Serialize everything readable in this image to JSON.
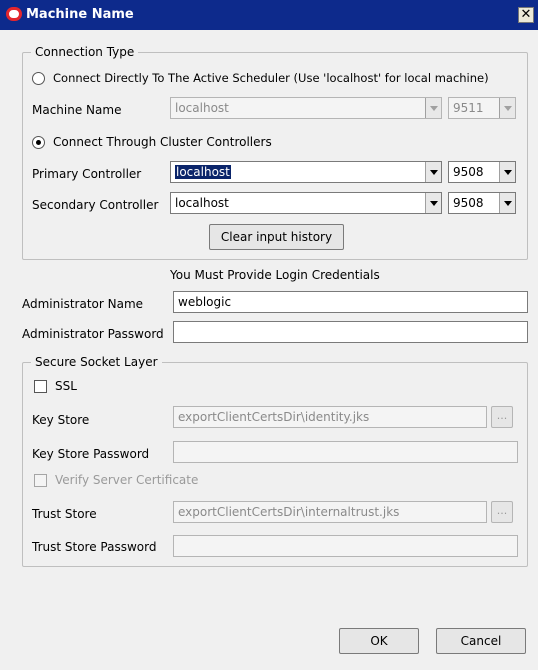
{
  "window": {
    "title": "Machine Name",
    "close_glyph": "✕"
  },
  "connection": {
    "legend": "Connection Type",
    "direct_option": "Connect Directly To The Active Scheduler (Use 'localhost' for local machine)",
    "machine_name_label": "Machine Name",
    "machine_name_value": "localhost",
    "machine_port_value": "9511",
    "cluster_option": "Connect Through Cluster Controllers",
    "primary_label": "Primary Controller",
    "primary_value": "localhost",
    "primary_port": "9508",
    "secondary_label": "Secondary Controller",
    "secondary_value": "localhost",
    "secondary_port": "9508",
    "clear_history": "Clear input history",
    "selected_option": "cluster"
  },
  "credentials": {
    "heading": "You Must Provide Login Credentials",
    "admin_name_label": "Administrator Name",
    "admin_name_value": "weblogic",
    "admin_password_label": "Administrator Password",
    "admin_password_value": ""
  },
  "ssl": {
    "legend": "Secure Socket Layer",
    "ssl_label": "SSL",
    "ssl_checked": false,
    "key_store_label": "Key Store",
    "key_store_value": "exportClientCertsDir\\identity.jks",
    "key_store_password_label": "Key Store Password",
    "key_store_password_value": "",
    "verify_label": "Verify Server Certificate",
    "trust_store_label": "Trust Store",
    "trust_store_value": "exportClientCertsDir\\internaltrust.jks",
    "trust_store_password_label": "Trust Store Password",
    "trust_store_password_value": "",
    "browse_label": "..."
  },
  "actions": {
    "ok": "OK",
    "cancel": "Cancel"
  }
}
